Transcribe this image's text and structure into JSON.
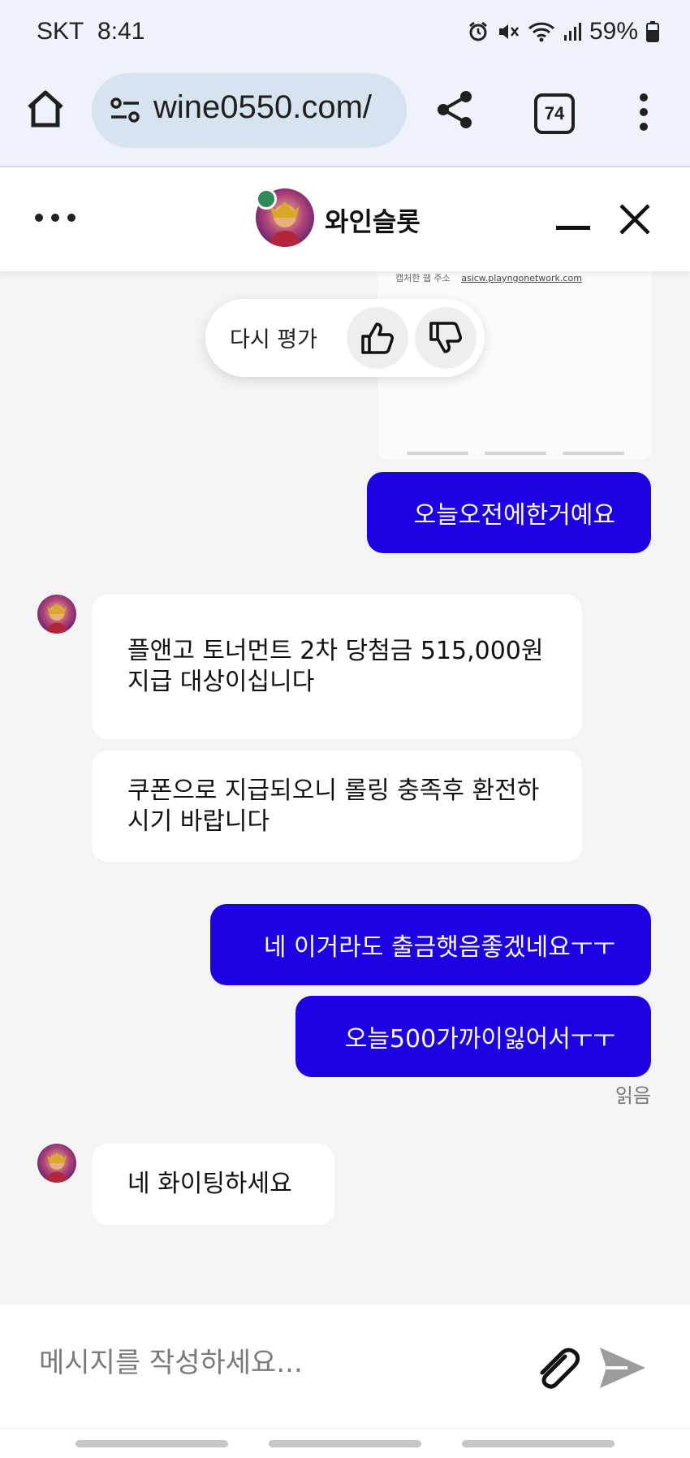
{
  "status_bar": {
    "carrier": "SKT",
    "time": "8:41",
    "battery": "59%"
  },
  "browser": {
    "url": "wine0550.com/",
    "tab_count": "74"
  },
  "chat_header": {
    "title": "와인슬롯",
    "online": true
  },
  "image_card": {
    "caption_label": "캡처한 웹 주소",
    "caption_url": "asicw.playngonetwork.com"
  },
  "rating": {
    "label": "다시 평가"
  },
  "messages": [
    {
      "sender": "user",
      "text": "오늘오전에한거예요"
    },
    {
      "sender": "bot",
      "text": "플앤고 토너먼트 2차 당첨금 515,000원 지급 대상이십니다"
    },
    {
      "sender": "bot",
      "text": "쿠폰으로 지급되오니 롤링 충족후 환전하시기 바랍니다"
    },
    {
      "sender": "user",
      "text": "네 이거라도 출금햇음좋겠네요ㅜㅜ"
    },
    {
      "sender": "user",
      "text": "오늘500가까이잃어서ㅜㅜ"
    },
    {
      "sender": "bot",
      "text": "네 화이팅하세요"
    }
  ],
  "read_status": "읽음",
  "composer": {
    "placeholder": "메시지를 작성하세요..."
  },
  "colors": {
    "user_bubble": "#1d00e2",
    "online_dot": "#2e8b57",
    "browser_bg": "#eef3fb"
  }
}
